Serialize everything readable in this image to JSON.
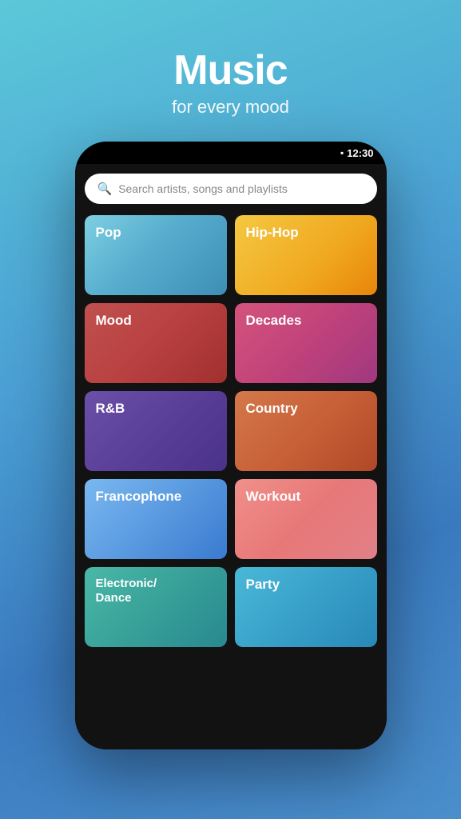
{
  "header": {
    "title": "Music",
    "subtitle": "for every mood"
  },
  "status_bar": {
    "time": "12:30",
    "battery_icon": "🔋"
  },
  "search": {
    "placeholder": "Search artists, songs and playlists"
  },
  "tiles": [
    {
      "id": "pop",
      "label": "Pop",
      "css_class": "tile-pop"
    },
    {
      "id": "hiphop",
      "label": "Hip-Hop",
      "css_class": "tile-hiphop"
    },
    {
      "id": "mood",
      "label": "Mood",
      "css_class": "tile-mood"
    },
    {
      "id": "decades",
      "label": "Decades",
      "css_class": "tile-decades"
    },
    {
      "id": "rnb",
      "label": "R&B",
      "css_class": "tile-rnb"
    },
    {
      "id": "country",
      "label": "Country",
      "css_class": "tile-country"
    },
    {
      "id": "francophone",
      "label": "Francophone",
      "css_class": "tile-francophone"
    },
    {
      "id": "workout",
      "label": "Workout",
      "css_class": "tile-workout"
    },
    {
      "id": "electronic",
      "label": "Electronic/\nDance",
      "css_class": "tile-electronic"
    },
    {
      "id": "party",
      "label": "Party",
      "css_class": "tile-party"
    }
  ]
}
